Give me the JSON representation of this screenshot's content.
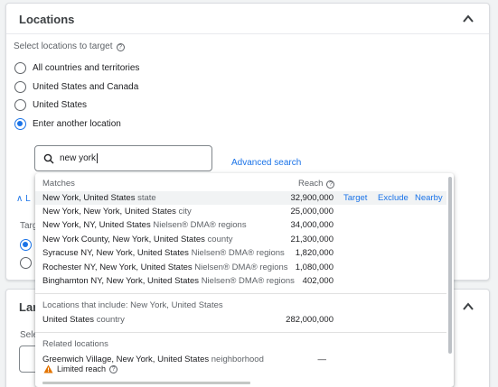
{
  "top_card": {
    "title": "Locations"
  },
  "select_label": "Select locations to target",
  "radios": [
    {
      "label": "All countries and territories",
      "selected": false
    },
    {
      "label": "United States and Canada",
      "selected": false
    },
    {
      "label": "United States",
      "selected": false
    },
    {
      "label": "Enter another location",
      "selected": true
    }
  ],
  "search": {
    "value": "new york",
    "advanced_link": "Advanced search"
  },
  "behind": {
    "left_l": "L",
    "targ": "Targ"
  },
  "bottom_card": {
    "title_partial": "Lan",
    "sub_partial": "Sele"
  },
  "dropdown": {
    "matches_header": "Matches",
    "reach_header": "Reach",
    "matches": [
      {
        "name": "New York, United States",
        "type": "state",
        "reach": "32,900,000",
        "highlighted": true
      },
      {
        "name": "New York, New York, United States",
        "type": "city",
        "reach": "25,000,000"
      },
      {
        "name": "New York, NY, United States",
        "type": "Nielsen® DMA® regions",
        "reach": "34,000,000"
      },
      {
        "name": "New York County, New York, United States",
        "type": "county",
        "reach": "21,300,000"
      },
      {
        "name": "Syracuse NY, New York, United States",
        "type": "Nielsen® DMA® regions",
        "reach": "1,820,000"
      },
      {
        "name": "Rochester NY, New York, United States",
        "type": "Nielsen® DMA® regions",
        "reach": "1,080,000"
      },
      {
        "name": "Binghamton NY, New York, United States",
        "type": "Nielsen® DMA® regions",
        "reach": "402,000"
      }
    ],
    "actions": {
      "target": "Target",
      "exclude": "Exclude",
      "nearby": "Nearby"
    },
    "includes_header": "Locations that include: New York, United States",
    "includes": [
      {
        "name": "United States",
        "type": "country",
        "reach": "282,000,000"
      }
    ],
    "related_header": "Related locations",
    "related": [
      {
        "name": "Greenwich Village, New York, United States",
        "type": "neighborhood",
        "reach": "—",
        "warning": "Limited reach"
      }
    ]
  },
  "colors": {
    "accent": "#1a73e8",
    "warning": "#e37400"
  }
}
